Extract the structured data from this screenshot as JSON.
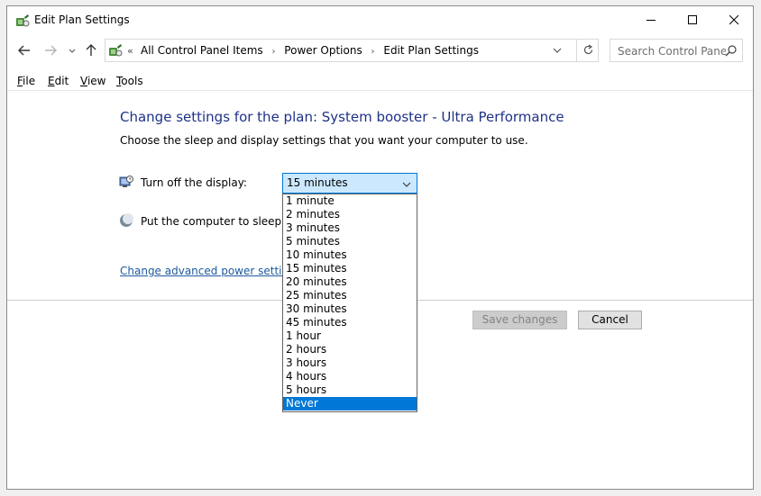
{
  "window": {
    "title": "Edit Plan Settings"
  },
  "address": {
    "overflow": "«",
    "breadcrumbs": [
      "All Control Panel Items",
      "Power Options",
      "Edit Plan Settings"
    ]
  },
  "search": {
    "placeholder": "Search Control Panel"
  },
  "menu": {
    "file": {
      "accel": "F",
      "rest": "ile"
    },
    "edit": {
      "accel": "E",
      "rest": "dit"
    },
    "view": {
      "accel": "V",
      "rest": "iew"
    },
    "tools": {
      "accel": "T",
      "rest": "ools"
    }
  },
  "content": {
    "heading": "Change settings for the plan: System booster - Ultra Performance",
    "subtext": "Choose the sleep and display settings that you want your computer to use.",
    "display_label": "Turn off the display:",
    "sleep_label": "Put the computer to sleep:",
    "display_value": "15 minutes",
    "advanced_link": "Change advanced power settings"
  },
  "dropdown": {
    "options": [
      "1 minute",
      "2 minutes",
      "3 minutes",
      "5 minutes",
      "10 minutes",
      "15 minutes",
      "20 minutes",
      "25 minutes",
      "30 minutes",
      "45 minutes",
      "1 hour",
      "2 hours",
      "3 hours",
      "4 hours",
      "5 hours",
      "Never"
    ],
    "highlighted": "Never"
  },
  "buttons": {
    "save": "Save changes",
    "cancel": "Cancel"
  },
  "colors": {
    "heading": "#1e3287",
    "link": "#1e5aa0",
    "selection": "#0078d7",
    "select_bg": "#cce8ff"
  }
}
